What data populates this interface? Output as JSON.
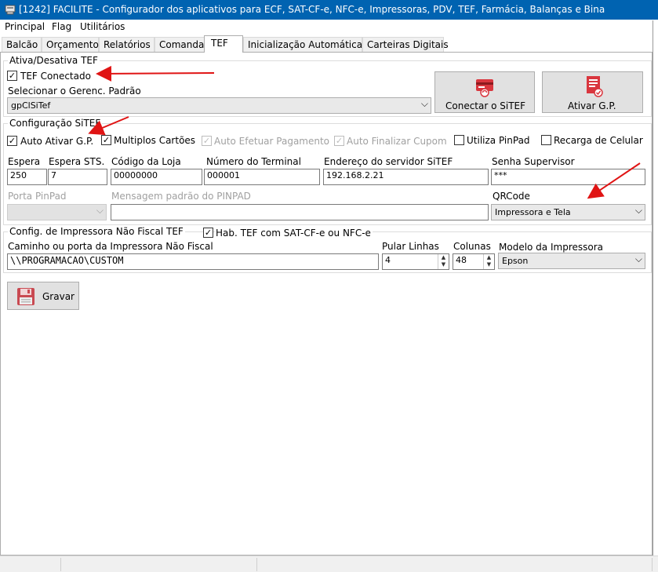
{
  "window": {
    "title": "[1242] FACILITE - Configurador dos aplicativos para ECF, SAT-CF-e, NFC-e, Impressoras, PDV, TEF, Farmácia, Balanças e Bina"
  },
  "menu": [
    "Principal",
    "Flag",
    "Utilitários"
  ],
  "tabs": [
    "Balcão",
    "Orçamento",
    "Relatórios",
    "Comanda",
    "TEF",
    "Inicialização Automática",
    "Carteiras Digitais"
  ],
  "activeTab": "TEF",
  "ativa": {
    "title": "Ativa/Desativa TEF",
    "tef_conectado": "TEF Conectado",
    "gerenc_label": "Selecionar o Gerenc. Padrão",
    "gerenc_value": "gpClSiTef",
    "conectar_btn": "Conectar o SiTEF",
    "ativar_btn": "Ativar G.P."
  },
  "config": {
    "title": "Configuração SiTEF",
    "auto_ativar": "Auto Ativar G.P.",
    "multiplos": "Multiplos Cartões",
    "auto_efetuar": "Auto Efetuar Pagamento",
    "auto_finalizar": "Auto Finalizar Cupom",
    "utiliza_pinpad": "Utiliza PinPad",
    "recarga": "Recarga de Celular",
    "espera_label": "Espera",
    "espera_value": "250",
    "espera_sts_label": "Espera STS.",
    "espera_sts_value": "7",
    "codigo_loja_label": "Código da Loja",
    "codigo_loja_value": "00000000",
    "numero_terminal_label": "Número do Terminal",
    "numero_terminal_value": "000001",
    "endereco_label": "Endereço do servidor SiTEF",
    "endereco_value": "192.168.2.21",
    "senha_label": "Senha Supervisor",
    "senha_value": "***",
    "porta_pinpad_label": "Porta PinPad",
    "mensagem_label": "Mensagem padrão do PINPAD",
    "qrcode_label": "QRCode",
    "qrcode_value": "Impressora e Tela"
  },
  "impressora": {
    "title": "Config. de Impressora Não Fiscal TEF",
    "hab_tef": "Hab. TEF com SAT-CF-e ou NFC-e",
    "caminho_label": "Caminho ou porta da Impressora Não Fiscal",
    "caminho_value": "\\\\PROGRAMACAO\\CUSTOM",
    "pular_label": "Pular Linhas",
    "pular_value": "4",
    "colunas_label": "Colunas",
    "colunas_value": "48",
    "modelo_label": "Modelo da Impressora",
    "modelo_value": "Epson"
  },
  "gravar_btn": "Gravar",
  "colors": {
    "titlebar": "#0063b1",
    "annotation_arrow": "#e01414",
    "icon_red": "#d9363e"
  }
}
